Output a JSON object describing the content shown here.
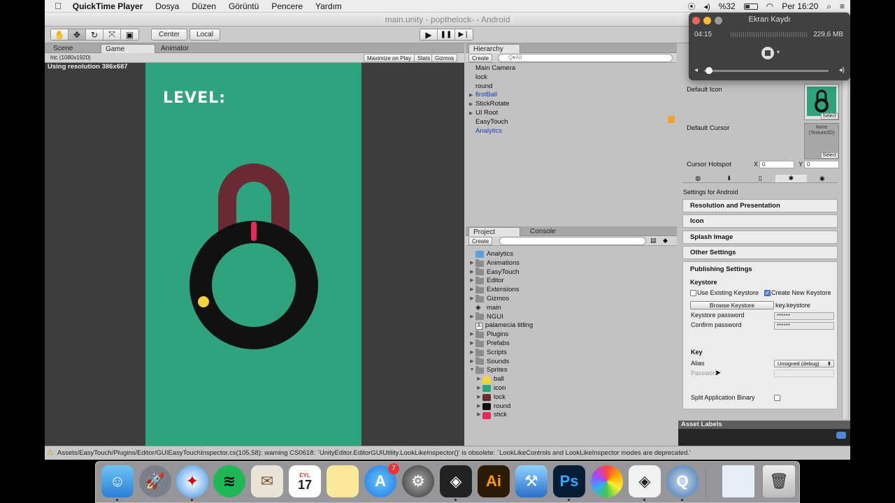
{
  "menubar": {
    "apple": "",
    "app": "QuickTime Player",
    "items": [
      "Dosya",
      "Düzen",
      "Görüntü",
      "Pencere",
      "Yardım"
    ],
    "battery": "%32",
    "clock": "Per 16:20"
  },
  "unity": {
    "window_title": "main.unity - popthelock- - Android",
    "toolbar": {
      "center": "Center",
      "local": "Local"
    },
    "game_tabs": {
      "scene": "Scene",
      "game": "Game",
      "animator": "Animator"
    },
    "game_bar": {
      "resolution_select": "htc (1080x1920)",
      "maximize": "Maximize on Play",
      "stats": "Stats",
      "gizmos": "Gizmos"
    },
    "resolution_note": "Using resolution 386x687",
    "game": {
      "level_text": "LEVEL:"
    },
    "hierarchy": {
      "tab": "Hierarchy",
      "create": "Create",
      "search_placeholder": "Q▾All",
      "items": [
        {
          "label": "Main Camera",
          "arrow": false,
          "blue": false
        },
        {
          "label": "lock",
          "arrow": false,
          "blue": false
        },
        {
          "label": "round",
          "arrow": false,
          "blue": false
        },
        {
          "label": "firstBall",
          "arrow": true,
          "blue": true
        },
        {
          "label": "StickRotate",
          "arrow": true,
          "blue": false
        },
        {
          "label": "UI Root",
          "arrow": true,
          "blue": false
        },
        {
          "label": "EasyTouch",
          "arrow": false,
          "blue": false
        },
        {
          "label": "Analytics",
          "arrow": false,
          "blue": true
        }
      ]
    },
    "project": {
      "tab": "Project",
      "console_tab": "Console",
      "create": "Create",
      "items": [
        {
          "label": "Analytics",
          "kind": "package"
        },
        {
          "label": "Animations",
          "kind": "folder"
        },
        {
          "label": "EasyTouch",
          "kind": "folder"
        },
        {
          "label": "Editor",
          "kind": "folder"
        },
        {
          "label": "Extensions",
          "kind": "folder"
        },
        {
          "label": "Gizmos",
          "kind": "folder"
        },
        {
          "label": "main",
          "kind": "unity"
        },
        {
          "label": "NGUI",
          "kind": "folder"
        },
        {
          "label": "palamecia titling",
          "kind": "font"
        },
        {
          "label": "Plugins",
          "kind": "folder"
        },
        {
          "label": "Prefabs",
          "kind": "folder"
        },
        {
          "label": "Scripts",
          "kind": "folder"
        },
        {
          "label": "Sounds",
          "kind": "folder"
        },
        {
          "label": "Sprites",
          "kind": "folder-open"
        }
      ],
      "sprites": [
        {
          "label": "ball",
          "color": "#f5d33a"
        },
        {
          "label": "icon",
          "color": "#2ea37e"
        },
        {
          "label": "lock",
          "color": "#6a2a34"
        },
        {
          "label": "round",
          "color": "#111111"
        },
        {
          "label": "stick",
          "color": "#e8285a"
        }
      ]
    },
    "inspector": {
      "default_icon": "Default Icon",
      "select": "Select",
      "default_cursor": "Default Cursor",
      "cursor_none": "None (Texture2D)",
      "cursor_hotspot": "Cursor Hotspot",
      "x_label": "X",
      "x_value": "0",
      "y_label": "Y",
      "y_value": "0",
      "settings_for": "Settings for Android",
      "sections": [
        "Resolution and Presentation",
        "Icon",
        "Splash Image",
        "Other Settings"
      ],
      "publishing": "Publishing Settings",
      "keystore": "Keystore",
      "use_existing": "Use Existing Keystore",
      "create_new": "Create New Keystore",
      "browse": "Browse Keystore",
      "keystore_file": "key.keystore",
      "keystore_password": "Keystore password",
      "confirm_password": "Confirm password",
      "password_mask": "******",
      "key": "Key",
      "alias": "Alias",
      "alias_value": "Unsigned (debug)",
      "password": "Password",
      "split": "Split Application Binary",
      "asset_labels": "Asset Labels"
    },
    "status": "Assets/EasyTouch/Plugins/Editor/GUIEasyTouchInspector.cs(105,58): warning CS0618: `UnityEditor.EditorGUIUtility.LookLikeInspector()' is obsolete: `LookLikeControls and LookLikeInspector modes are deprecated.'"
  },
  "recorder": {
    "title": "Ekran Kaydı",
    "time": "04:15",
    "size": "229,6 MB"
  },
  "dock": {
    "calendar_month": "EYL",
    "calendar_day": "17",
    "badge": "7",
    "illustrator": "Ai",
    "photoshop": "Ps"
  }
}
